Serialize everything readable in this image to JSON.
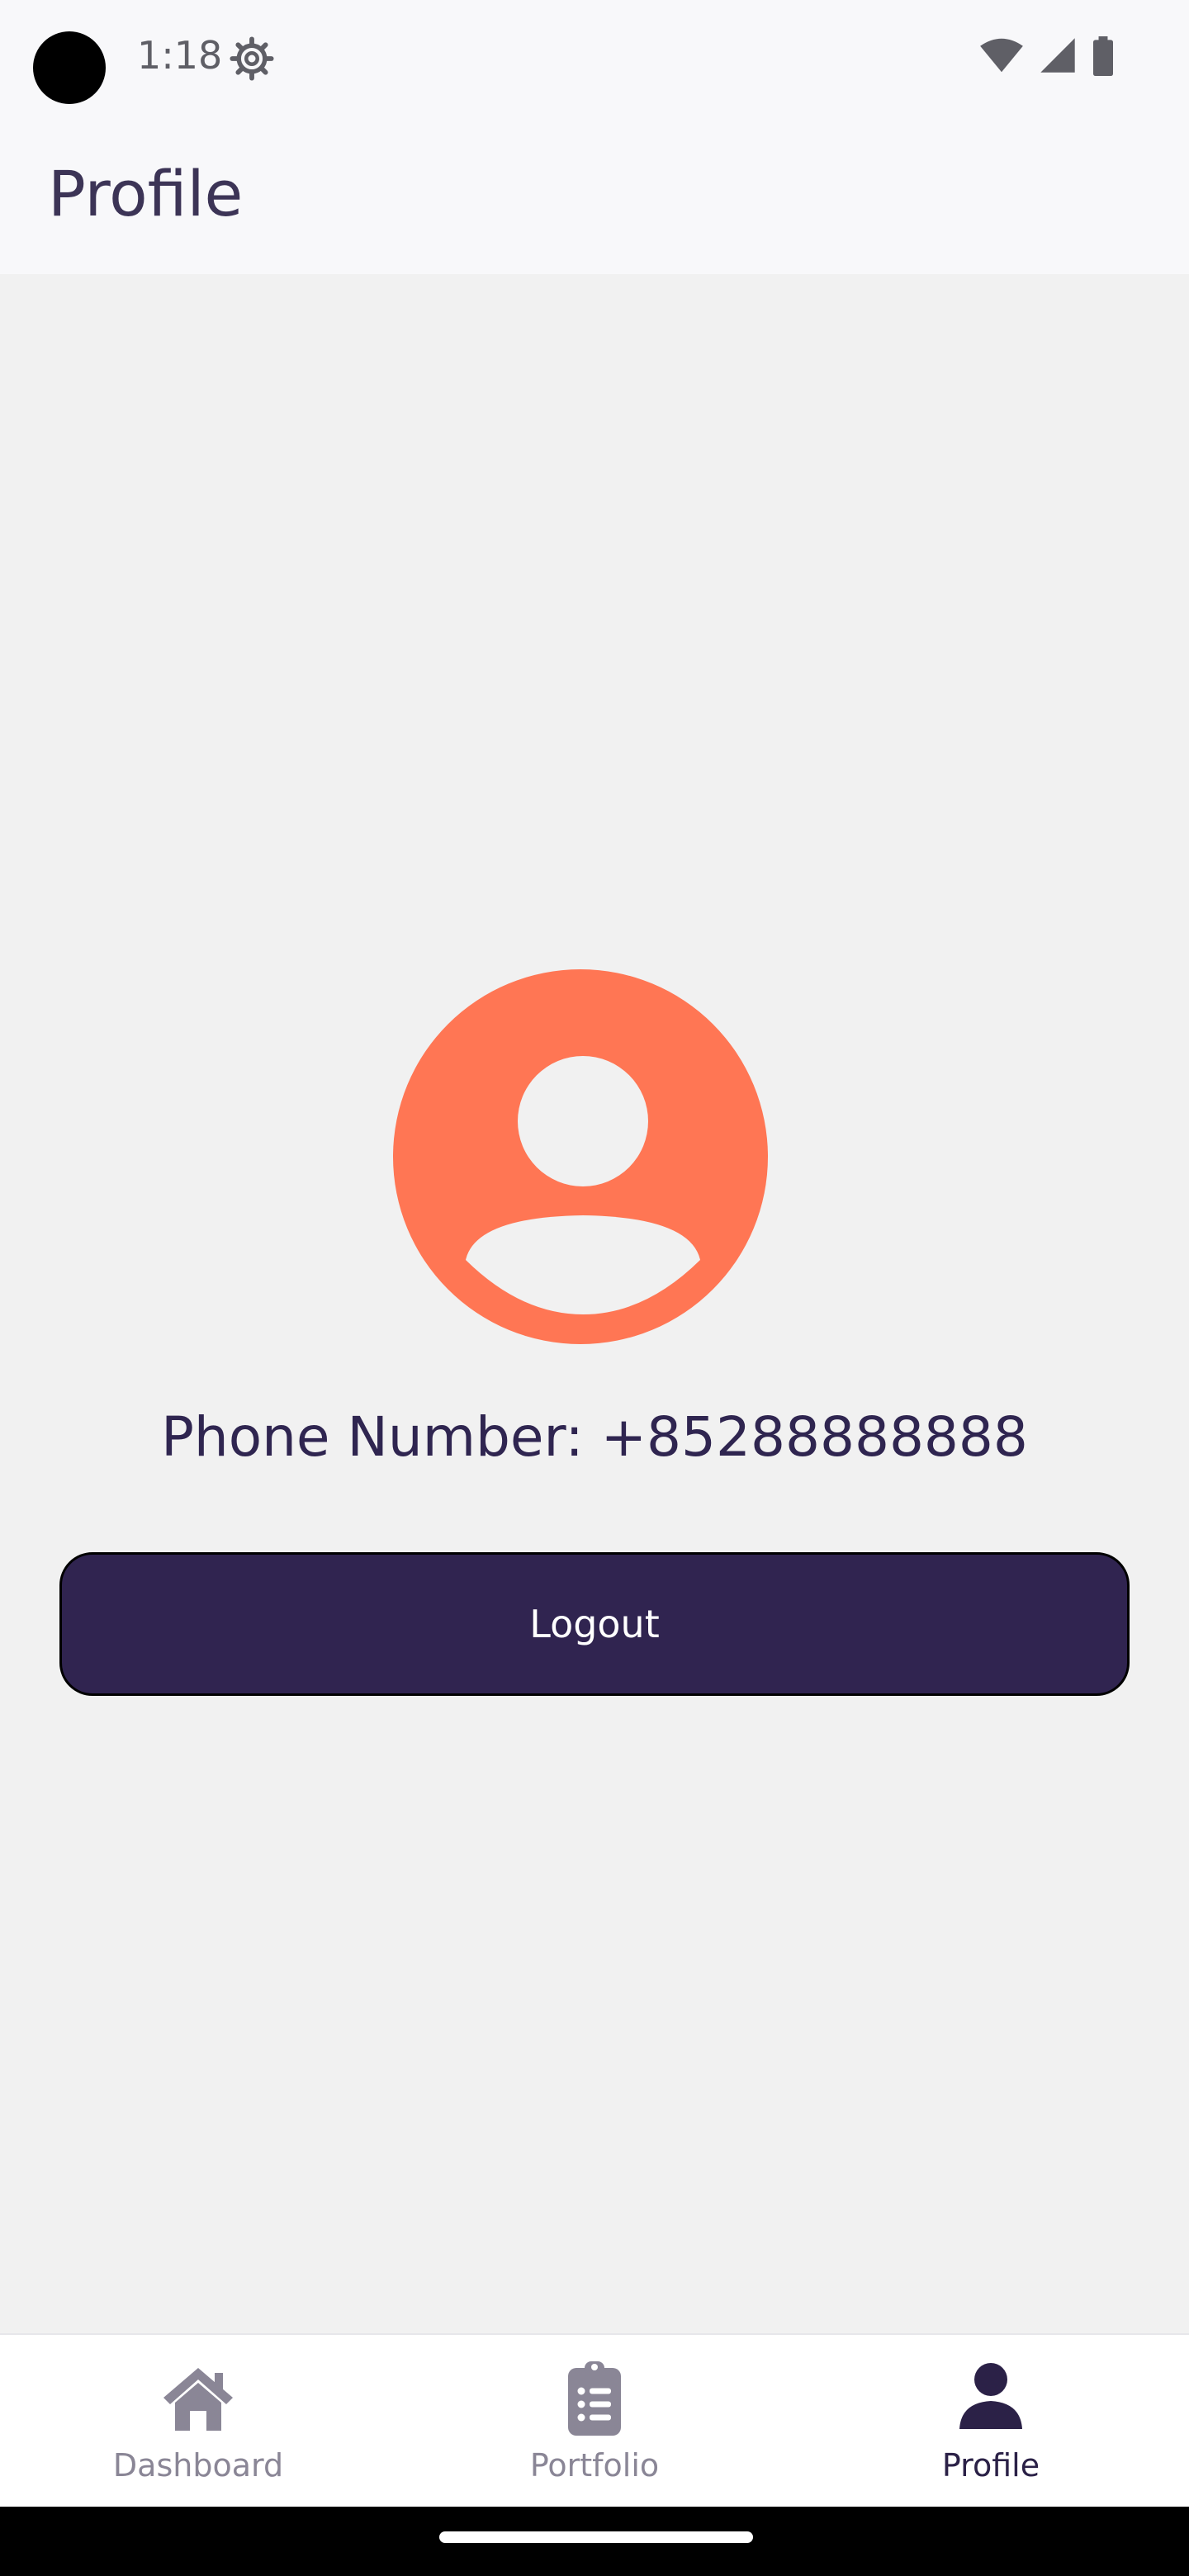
{
  "status_bar": {
    "time": "1:18",
    "icons": [
      "settings-icon",
      "wifi-icon",
      "cellular-signal-icon",
      "battery-icon"
    ]
  },
  "app_bar": {
    "title": "Profile"
  },
  "profile": {
    "avatar_icon": "account-circle-icon",
    "phone_text": "Phone Number: +85288888888",
    "logout_label": "Logout"
  },
  "bottom_nav": {
    "items": [
      {
        "label": "Dashboard",
        "icon": "home-icon",
        "active": false
      },
      {
        "label": "Portfolio",
        "icon": "clipboard-list-icon",
        "active": false
      },
      {
        "label": "Profile",
        "icon": "person-icon",
        "active": true
      }
    ]
  },
  "colors": {
    "accent": "#ff7654",
    "primary": "#302450",
    "nav_active": "#2b2147",
    "nav_inactive": "#8a8696",
    "background": "#f1f1f1"
  }
}
